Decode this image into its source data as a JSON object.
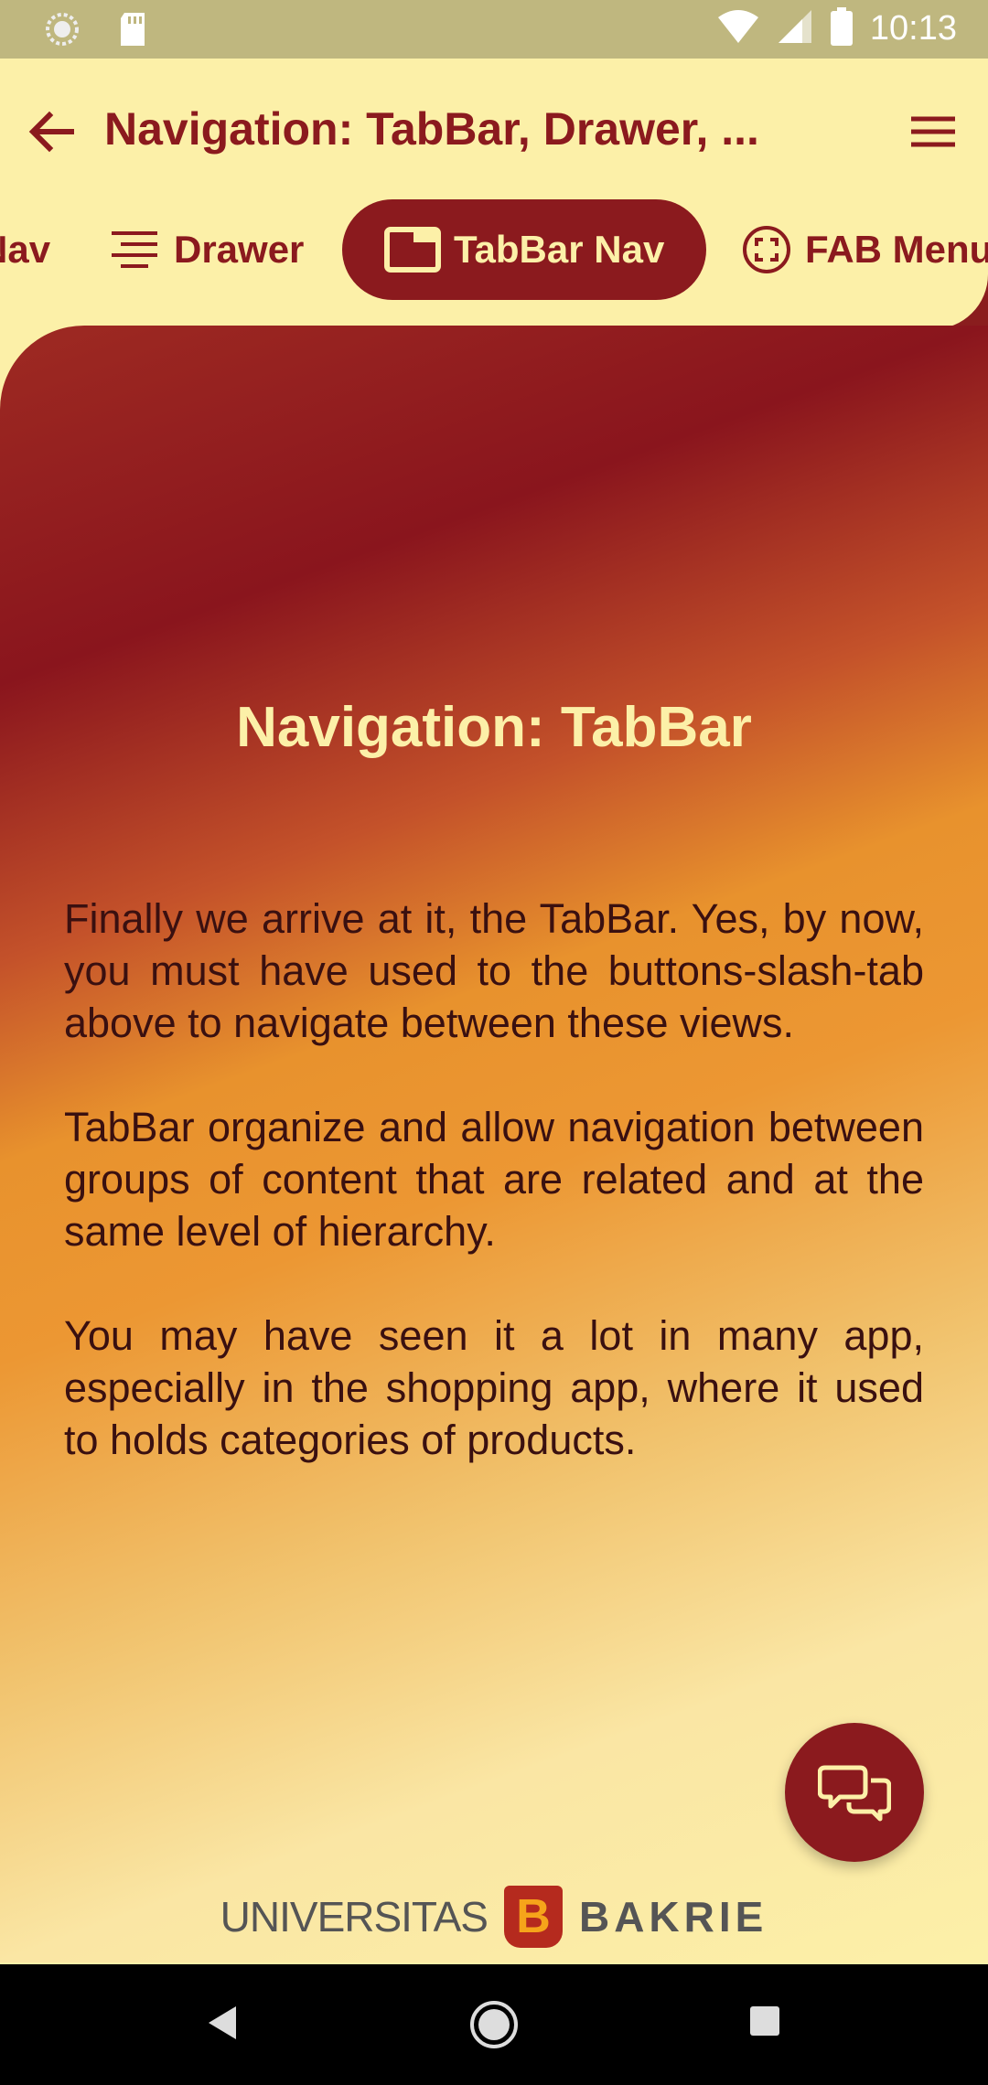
{
  "status_bar": {
    "time": "10:13"
  },
  "app_bar": {
    "title": "Navigation: TabBar, Drawer, ..."
  },
  "tabs": [
    {
      "label": "Nav",
      "icon": "nav-icon"
    },
    {
      "label": "Drawer",
      "icon": "drawer-lines-icon"
    },
    {
      "label": "TabBar Nav",
      "icon": "tab-window-icon",
      "active": true
    },
    {
      "label": "FAB Menu",
      "icon": "fab-focus-icon"
    }
  ],
  "content": {
    "title": "Navigation: TabBar",
    "paragraphs": [
      "Finally we arrive at it, the TabBar. Yes, by now, you must have used to the buttons-slash-tab above to navigate between these views.",
      "TabBar organize and allow navigation between groups of content that are related and at the same level of hierarchy.",
      "You may have seen it a lot in many app, especially in the shopping app, where it used to holds categories of products."
    ]
  },
  "footer": {
    "left": "UNIVERSITAS",
    "mark": "B",
    "right": "BAKRIE"
  },
  "colors": {
    "primary": "#8b1a1e",
    "background": "#fcf0a8",
    "accent": "#ec9733"
  }
}
